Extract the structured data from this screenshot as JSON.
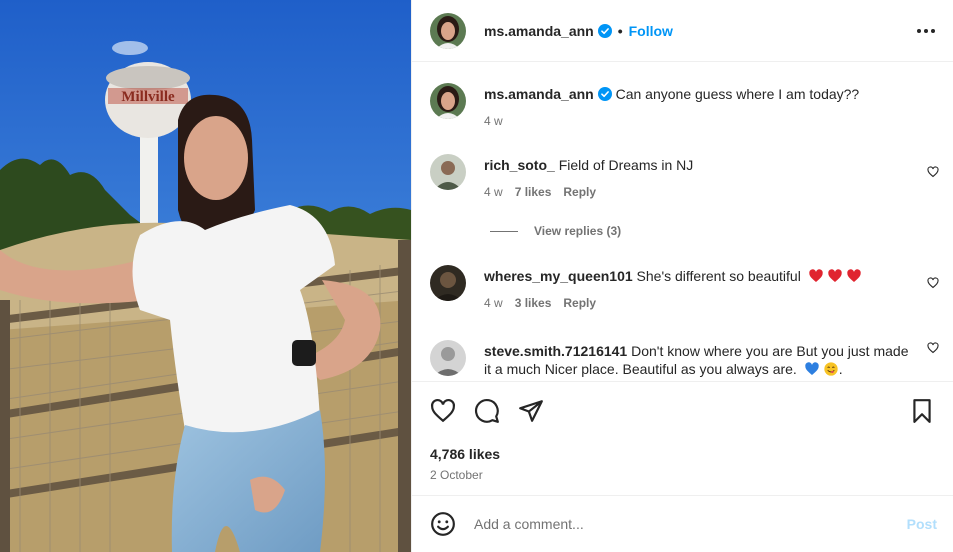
{
  "post": {
    "username": "ms.amanda_ann",
    "follow_label": "Follow",
    "separator": "•",
    "caption": "Can anyone guess where I am today??",
    "caption_age": "4 w",
    "tower_text": "Millville"
  },
  "comments": [
    {
      "username": "rich_soto_",
      "text": "Field of Dreams in NJ",
      "age": "4 w",
      "likes": "7 likes",
      "reply": "Reply"
    },
    {
      "username": "wheres_my_queen101",
      "text": "She's different so beautiful",
      "emoji": [
        "red-heart",
        "red-heart",
        "red-heart"
      ],
      "age": "4 w",
      "likes": "3 likes",
      "reply": "Reply"
    },
    {
      "username": "steve.smith.71216141",
      "text": "Don't know where you are But you just made it a much Nicer place. Beautiful as you always are.",
      "emoji": [
        "blue-heart",
        "yum-face"
      ],
      "trailing": "."
    }
  ],
  "view_replies": "View replies (3)",
  "likes_count": "4,786 likes",
  "post_date": "2 October",
  "add_comment": {
    "placeholder": "Add a comment...",
    "post_label": "Post"
  },
  "icons": [
    "verified-badge-icon",
    "more-options-icon",
    "like-icon",
    "comment-icon",
    "share-icon",
    "save-icon",
    "emoji-icon",
    "small-heart-icon"
  ],
  "colors": {
    "link_blue": "#0095f6",
    "post_disabled": "#b2dffc",
    "muted": "#737373",
    "heart_red": "#e0242f"
  }
}
